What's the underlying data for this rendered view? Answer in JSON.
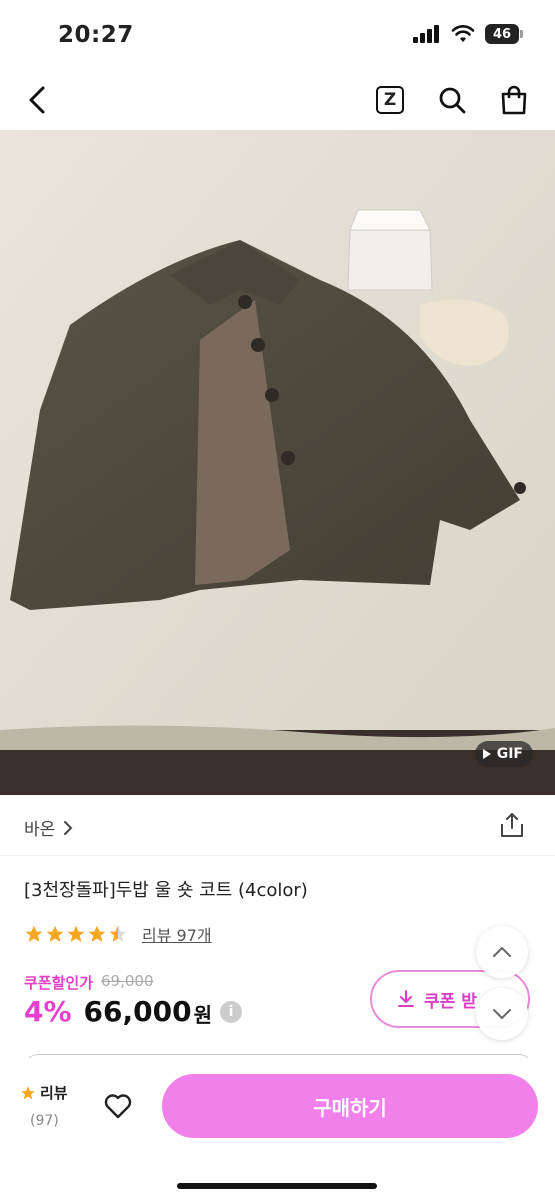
{
  "status": {
    "time": "20:27",
    "battery": "46"
  },
  "nav": {
    "back_icon": "chevron-left-icon",
    "z_icon_label": "Z",
    "search_icon": "search-icon",
    "cart_icon": "shopping-bag-icon"
  },
  "hero": {
    "gif_label": "GIF"
  },
  "brand": {
    "name": "바온"
  },
  "product": {
    "title": "[3천장돌파]두밥 울 숏 코트 (4color)",
    "rating": 4.5,
    "review_link": "리뷰 97개",
    "coupon_label": "쿠폰할인가",
    "original_price": "69,000",
    "discount": "4%",
    "price": "66,000",
    "currency": "원",
    "info": "i"
  },
  "coupon_button": {
    "label": "쿠폰 받"
  },
  "bottom": {
    "review_label": "리뷰",
    "review_count": "(97)",
    "buy_label": "구매하기"
  },
  "colors": {
    "accent": "#f280ea",
    "accent_text": "#e83fd0",
    "star": "#f5a623"
  }
}
